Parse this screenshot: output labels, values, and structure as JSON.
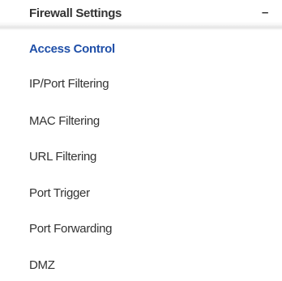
{
  "section": {
    "title": "Firewall Settings",
    "toggle_symbol": "–",
    "toggle_icon": "collapse-minus-icon"
  },
  "colors": {
    "active_item": "#1f4fa8",
    "text": "#333333"
  },
  "items": [
    {
      "label": "Access Control",
      "active": true
    },
    {
      "label": "IP/Port Filtering",
      "active": false
    },
    {
      "label": "MAC Filtering",
      "active": false
    },
    {
      "label": "URL Filtering",
      "active": false
    },
    {
      "label": "Port Trigger",
      "active": false
    },
    {
      "label": "Port Forwarding",
      "active": false
    },
    {
      "label": "DMZ",
      "active": false
    }
  ]
}
